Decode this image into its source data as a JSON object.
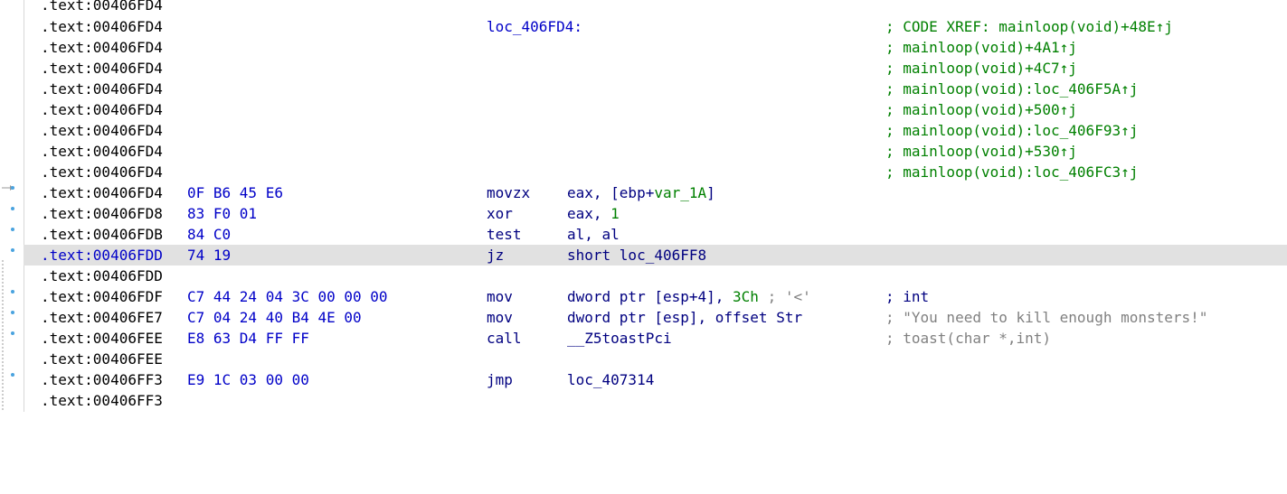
{
  "listing": {
    "rows": [
      {
        "addr": ".text:00406FD4",
        "bytes": "",
        "label": "",
        "mnem": "",
        "ops": "",
        "cmt": ""
      },
      {
        "addr": ".text:00406FD4",
        "bytes": "",
        "label": "loc_406FD4:",
        "mnem": "",
        "ops": "",
        "cmt": "; CODE XREF: mainloop(void)+48E↑j"
      },
      {
        "addr": ".text:00406FD4",
        "bytes": "",
        "label": "",
        "mnem": "",
        "ops": "",
        "cmt": "; mainloop(void)+4A1↑j"
      },
      {
        "addr": ".text:00406FD4",
        "bytes": "",
        "label": "",
        "mnem": "",
        "ops": "",
        "cmt": "; mainloop(void)+4C7↑j"
      },
      {
        "addr": ".text:00406FD4",
        "bytes": "",
        "label": "",
        "mnem": "",
        "ops": "",
        "cmt": "; mainloop(void):loc_406F5A↑j"
      },
      {
        "addr": ".text:00406FD4",
        "bytes": "",
        "label": "",
        "mnem": "",
        "ops": "",
        "cmt": "; mainloop(void)+500↑j"
      },
      {
        "addr": ".text:00406FD4",
        "bytes": "",
        "label": "",
        "mnem": "",
        "ops": "",
        "cmt": "; mainloop(void):loc_406F93↑j"
      },
      {
        "addr": ".text:00406FD4",
        "bytes": "",
        "label": "",
        "mnem": "",
        "ops": "",
        "cmt": "; mainloop(void)+530↑j"
      },
      {
        "addr": ".text:00406FD4",
        "bytes": "",
        "label": "",
        "mnem": "",
        "ops": "",
        "cmt": "; mainloop(void):loc_406FC3↑j"
      },
      {
        "addr": ".text:00406FD4",
        "bytes": "0F B6 45 E6",
        "label": "",
        "mnem": "movzx",
        "ops_a": "eax, [ebp+",
        "ops_b": "var_1A",
        "ops_c": "]",
        "cmt": ""
      },
      {
        "addr": ".text:00406FD8",
        "bytes": "83 F0 01",
        "label": "",
        "mnem": "xor",
        "ops_a": "eax, ",
        "ops_b": "1",
        "ops_c": "",
        "cmt": ""
      },
      {
        "addr": ".text:00406FDB",
        "bytes": "84 C0",
        "label": "",
        "mnem": "test",
        "ops_a": "al, al",
        "ops_b": "",
        "ops_c": "",
        "cmt": ""
      },
      {
        "addr": ".text:00406FDD",
        "bytes": "74 19",
        "label": "",
        "mnem": "jz",
        "ops_a": "short loc_406FF8",
        "ops_b": "",
        "ops_c": "",
        "cmt": ""
      },
      {
        "addr": ".text:00406FDD",
        "bytes": "",
        "label": "",
        "mnem": "",
        "ops": "",
        "cmt": ""
      },
      {
        "addr": ".text:00406FDF",
        "bytes": "C7 44 24 04 3C 00 00 00",
        "label": "",
        "mnem": "mov",
        "ops_a": "dword ptr [esp+4], ",
        "ops_b": "3Ch",
        "ops_c": " ; '<'",
        "cmt": "; int"
      },
      {
        "addr": ".text:00406FE7",
        "bytes": "C7 04 24 40 B4 4E 00",
        "label": "",
        "mnem": "mov",
        "ops_a": "dword ptr [esp], offset Str",
        "ops_b": "",
        "ops_c": "",
        "cmt": "; \"You need to kill enough monsters!\""
      },
      {
        "addr": ".text:00406FEE",
        "bytes": "E8 63 D4 FF FF",
        "label": "",
        "mnem": "call",
        "ops_a": "__Z5toastPci",
        "ops_b": "",
        "ops_c": "",
        "cmt": "; toast(char *,int)"
      },
      {
        "addr": ".text:00406FEE",
        "bytes": "",
        "label": "",
        "mnem": "",
        "ops": "",
        "cmt": ""
      },
      {
        "addr": ".text:00406FF3",
        "bytes": "E9 1C 03 00 00",
        "label": "",
        "mnem": "jmp",
        "ops_a": "loc_407314",
        "ops_b": "",
        "ops_c": "",
        "cmt": ""
      },
      {
        "addr": ".text:00406FF3",
        "bytes": "",
        "label": "",
        "mnem": "",
        "ops": "",
        "cmt": ""
      }
    ],
    "selected_row": 12
  },
  "colors": {
    "address": "#000000",
    "bytes": "#0000c8",
    "mnemonic": "#000080",
    "xref_comment": "#008000",
    "comment": "#808080",
    "immediate": "#008000",
    "selection": "#e1e1e1",
    "gutter_marker": "#4aa3df"
  }
}
